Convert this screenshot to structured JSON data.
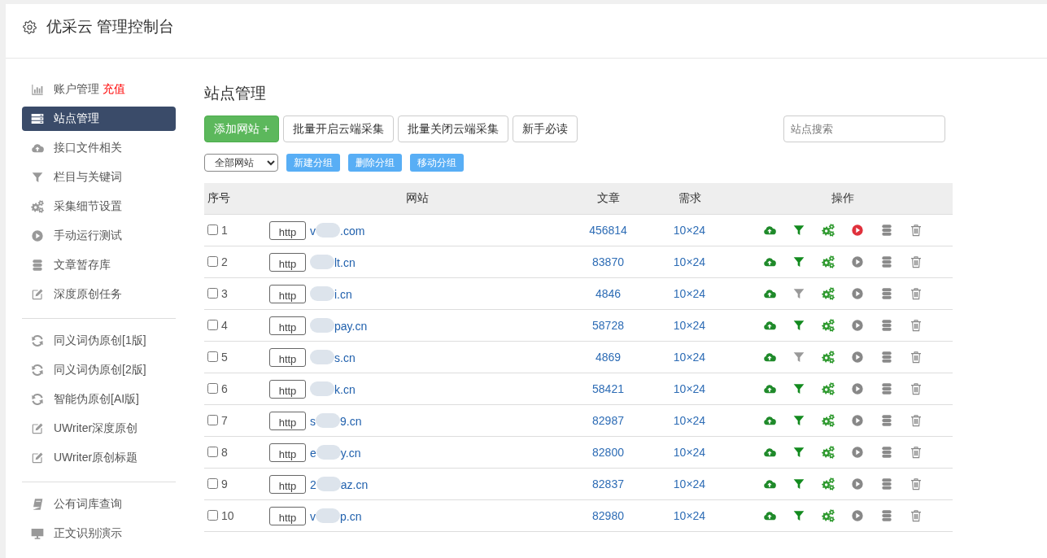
{
  "header": {
    "title": "优采云 管理控制台"
  },
  "sidebar": {
    "groups": [
      {
        "items": [
          {
            "label": "账户管理",
            "badge": "充值",
            "selected": false
          },
          {
            "label": "站点管理",
            "selected": true
          },
          {
            "label": "接口文件相关",
            "selected": false
          },
          {
            "label": "栏目与关键词",
            "selected": false
          },
          {
            "label": "采集细节设置",
            "selected": false
          },
          {
            "label": "手动运行测试",
            "selected": false
          },
          {
            "label": "文章暂存库",
            "selected": false
          },
          {
            "label": "深度原创任务",
            "selected": false
          }
        ]
      },
      {
        "items": [
          {
            "label": "同义词伪原创[1版]",
            "selected": false
          },
          {
            "label": "同义词伪原创[2版]",
            "selected": false
          },
          {
            "label": "智能伪原创[AI版]",
            "selected": false
          },
          {
            "label": "UWriter深度原创",
            "selected": false
          },
          {
            "label": "UWriter原创标题",
            "selected": false
          }
        ]
      },
      {
        "items": [
          {
            "label": "公有词库查询",
            "selected": false
          },
          {
            "label": "正文识别演示",
            "selected": false
          }
        ]
      }
    ]
  },
  "main": {
    "title": "站点管理",
    "toolbar": [
      {
        "label": "添加网站 +",
        "kind": "primary"
      },
      {
        "label": "批量开启云端采集",
        "kind": "default"
      },
      {
        "label": "批量关闭云端采集",
        "kind": "default"
      },
      {
        "label": "新手必读",
        "kind": "default"
      }
    ],
    "search": {
      "placeholder": "站点搜索"
    },
    "group_filter": {
      "value": "全部网站"
    },
    "group_buttons": [
      "新建分组",
      "删除分组",
      "移动分组"
    ]
  },
  "table": {
    "columns": [
      "序号",
      "网站",
      "文章",
      "需求",
      "操作"
    ],
    "rows": [
      {
        "checked": false,
        "index": "1",
        "protocol": "http",
        "domain_start": "v",
        "domain_end": ".com",
        "articles": "456814",
        "demand": "10×24",
        "filter_on": true,
        "running": true
      },
      {
        "checked": false,
        "index": "2",
        "protocol": "http",
        "domain_end": "lt.cn",
        "articles": "83870",
        "demand": "10×24",
        "filter_on": true,
        "running": false
      },
      {
        "checked": false,
        "index": "3",
        "protocol": "http",
        "domain_end": "i.cn",
        "articles": "4846",
        "demand": "10×24",
        "filter_on": false,
        "running": false
      },
      {
        "checked": false,
        "index": "4",
        "protocol": "http",
        "domain_end": "pay.cn",
        "articles": "58728",
        "demand": "10×24",
        "filter_on": true,
        "running": false
      },
      {
        "checked": false,
        "index": "5",
        "protocol": "http",
        "domain_end": "s.cn",
        "articles": "4869",
        "demand": "10×24",
        "filter_on": false,
        "running": false
      },
      {
        "checked": false,
        "index": "6",
        "protocol": "http",
        "domain_end": "k.cn",
        "articles": "58421",
        "demand": "10×24",
        "filter_on": true,
        "running": false
      },
      {
        "checked": false,
        "index": "7",
        "protocol": "http",
        "domain_start": "s",
        "domain_end": "9.cn",
        "articles": "82987",
        "demand": "10×24",
        "filter_on": true,
        "running": false
      },
      {
        "checked": false,
        "index": "8",
        "protocol": "http",
        "domain_start": "e",
        "domain_end": "y.cn",
        "articles": "82800",
        "demand": "10×24",
        "filter_on": true,
        "running": false
      },
      {
        "checked": false,
        "index": "9",
        "protocol": "http",
        "domain_start": "2",
        "domain_end": "az.cn",
        "articles": "82837",
        "demand": "10×24",
        "filter_on": true,
        "running": false
      },
      {
        "checked": false,
        "index": "10",
        "protocol": "http",
        "domain_start": "v",
        "domain_end": "p.cn",
        "articles": "82980",
        "demand": "10×24",
        "filter_on": true,
        "running": false
      }
    ]
  }
}
